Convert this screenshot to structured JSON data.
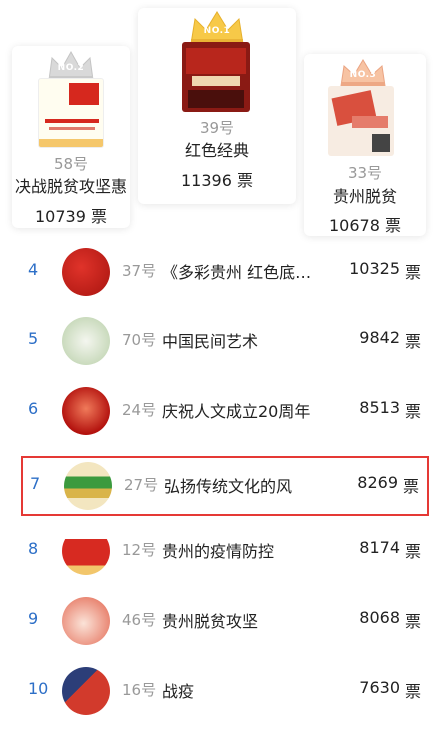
{
  "podium": [
    {
      "position": "second",
      "badge": "NO.2",
      "number": "58号",
      "title": "决战脱贫攻坚惠",
      "votes": "10739 票",
      "accent": "#c0c0c0"
    },
    {
      "position": "first",
      "badge": "NO.1",
      "number": "39号",
      "title": "红色经典",
      "votes": "11396 票",
      "accent": "#f5c442"
    },
    {
      "position": "third",
      "badge": "NO.3",
      "number": "33号",
      "title": "贵州脱贫",
      "votes": "10678 票",
      "accent": "#f2b48f"
    }
  ],
  "list": [
    {
      "rank": "4",
      "number": "37号",
      "name": "《多彩贵州 红色底…",
      "votes": "10325",
      "unit": "票"
    },
    {
      "rank": "5",
      "number": "70号",
      "name": "中国民间艺术",
      "votes": "9842",
      "unit": "票"
    },
    {
      "rank": "6",
      "number": "24号",
      "name": "庆祝人文成立20周年",
      "votes": "8513",
      "unit": "票"
    },
    {
      "rank": "7",
      "number": "27号",
      "name": "弘扬传统文化的风",
      "votes": "8269",
      "unit": "票"
    },
    {
      "rank": "8",
      "number": "12号",
      "name": "贵州的疫情防控",
      "votes": "8174",
      "unit": "票"
    },
    {
      "rank": "9",
      "number": "46号",
      "name": "贵州脱贫攻坚",
      "votes": "8068",
      "unit": "票"
    },
    {
      "rank": "10",
      "number": "16号",
      "name": "战疫",
      "votes": "7630",
      "unit": "票"
    }
  ],
  "colors": {
    "rank_blue": "#2d6fc7",
    "highlight_red": "#e53935",
    "muted_gray": "#999999"
  }
}
